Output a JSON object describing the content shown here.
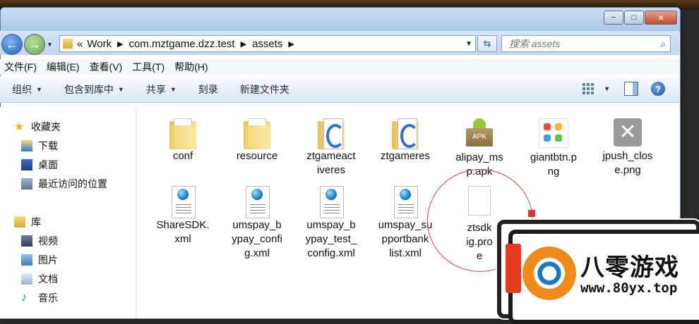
{
  "address": {
    "crumbs": [
      "Work",
      "com.mztgame.dzz.test",
      "assets"
    ],
    "prefix": "«"
  },
  "search": {
    "placeholder": "搜索 assets"
  },
  "menu": [
    "文件(F)",
    "编辑(E)",
    "查看(V)",
    "工具(T)",
    "帮助(H)"
  ],
  "toolbar": {
    "organize": "组织",
    "include": "包含到库中",
    "share": "共享",
    "burn": "刻录",
    "new_folder": "新建文件夹"
  },
  "sidebar": {
    "favorites": {
      "header": "收藏夹",
      "items": [
        "下载",
        "桌面",
        "最近访问的位置"
      ]
    },
    "libraries": {
      "header": "库",
      "items": [
        "视频",
        "图片",
        "文档",
        "音乐"
      ]
    }
  },
  "files": {
    "row1": [
      {
        "name": "conf",
        "type": "folder"
      },
      {
        "name": "resource",
        "type": "folder"
      },
      {
        "name": "ztgameact\niveres",
        "type": "bluefolder"
      },
      {
        "name": "ztgameres",
        "type": "bluefolder"
      },
      {
        "name": "alipay_ms\np.apk",
        "type": "apk"
      },
      {
        "name": "giantbtn.p\nng",
        "type": "png"
      },
      {
        "name": "jpush_clos\ne.png",
        "type": "png-close"
      }
    ],
    "row2": [
      {
        "name": "ShareSDK.\nxml",
        "type": "xml"
      },
      {
        "name": "umspay_b\nypay_confi\ng.xml",
        "type": "xml"
      },
      {
        "name": "umspay_b\nypay_test_\nconfig.xml",
        "type": "xml"
      },
      {
        "name": "umspay_su\npportbank\nlist.xml",
        "type": "xml"
      },
      {
        "name": "ztsdk\nig.pro\ne",
        "type": "blank"
      }
    ]
  },
  "watermark": {
    "title": "八零游戏",
    "url": "www.80yx.top"
  },
  "window_buttons": {
    "minimize": "−",
    "maximize": "□",
    "close": "✕"
  }
}
